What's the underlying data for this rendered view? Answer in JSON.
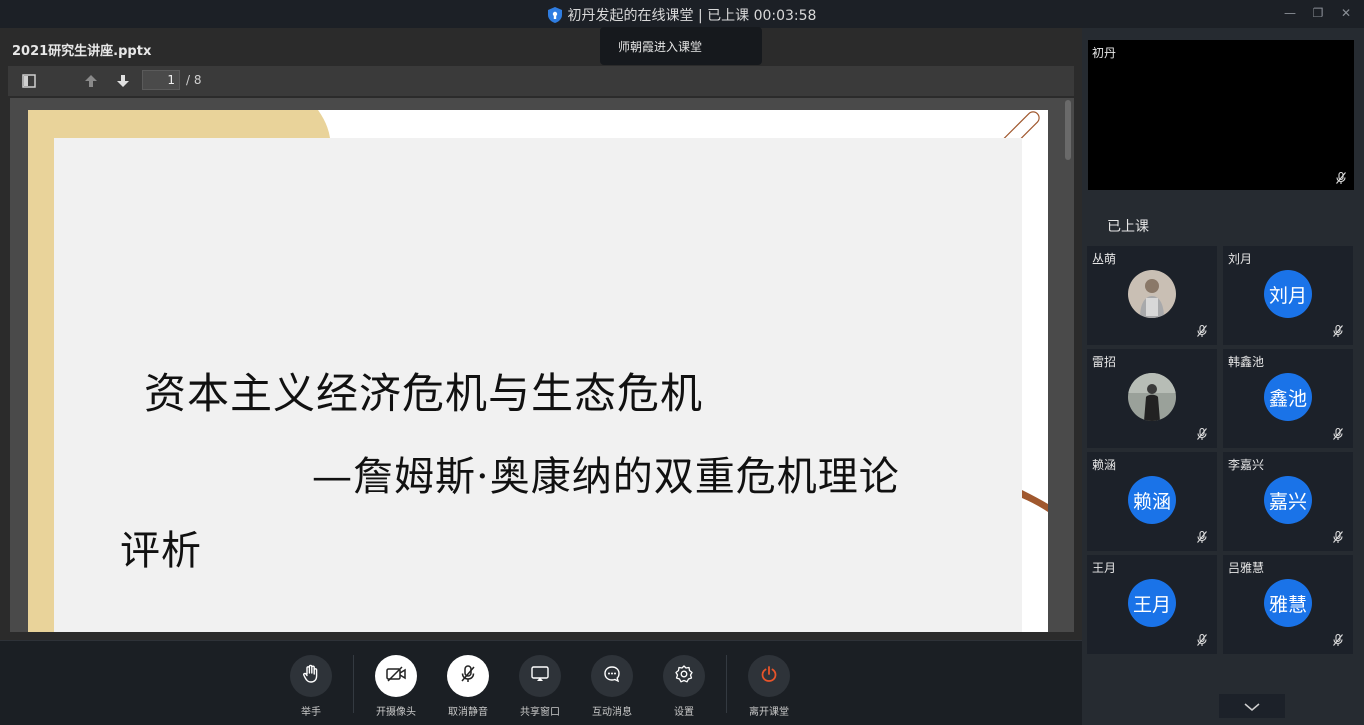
{
  "window": {
    "title": "初丹发起的在线课堂 | 已上课 00:03:58",
    "controls": [
      "minimize-icon",
      "restore-icon",
      "close-icon"
    ]
  },
  "notification": {
    "text": "师朝霞进入课堂"
  },
  "document": {
    "file_name": "2021研究生讲座.pptx",
    "current_page": "1",
    "total_pages": "/ 8",
    "slide": {
      "line1": "资本主义经济危机与生态危机",
      "line2": "—詹姆斯·奥康纳的双重危机理论",
      "line3": "评析",
      "colors": {
        "accent_brown": "#a0582e",
        "accent_tan": "#e9d39a",
        "line": "#c9917a"
      }
    }
  },
  "controls": {
    "raise_hand": "举手",
    "camera": "开摄像头",
    "mic": "取消静音",
    "share": "共享窗口",
    "chat": "互动消息",
    "settings": "设置",
    "leave": "离开课堂"
  },
  "panel": {
    "teacher_name": "初丹",
    "status": "已上课",
    "students": [
      {
        "name": "丛萌",
        "avatar_text": ""
      },
      {
        "name": "刘月",
        "avatar_text": "刘月"
      },
      {
        "name": "雷招",
        "avatar_text": ""
      },
      {
        "name": "韩鑫池",
        "avatar_text": "鑫池"
      },
      {
        "name": "赖涵",
        "avatar_text": "赖涵"
      },
      {
        "name": "李嘉兴",
        "avatar_text": "嘉兴"
      },
      {
        "name": "王月",
        "avatar_text": "王月"
      },
      {
        "name": "吕雅慧",
        "avatar_text": "雅慧"
      }
    ]
  },
  "colors": {
    "avatar_blue": "#1a73e8",
    "leave_red": "#e8542a"
  }
}
